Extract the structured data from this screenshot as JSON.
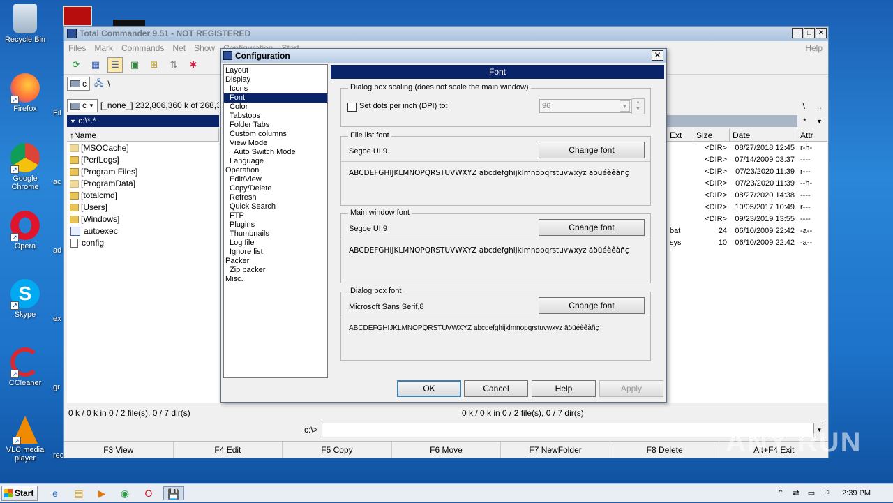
{
  "desktop": {
    "icons": [
      {
        "label": "Recycle Bin"
      },
      {
        "label": "Firefox"
      },
      {
        "label": "Google Chrome"
      },
      {
        "label": "Opera"
      },
      {
        "label": "Skype"
      },
      {
        "label": "CCleaner"
      },
      {
        "label": "VLC media player"
      }
    ],
    "partial_labels": [
      "Fil",
      "ac",
      "ad",
      "ex",
      "gr",
      "rec"
    ]
  },
  "main_window": {
    "title": "Total Commander 9.51 - NOT REGISTERED",
    "menu": [
      "Files",
      "Mark",
      "Commands",
      "Net",
      "Show",
      "Configuration",
      "Start"
    ],
    "help": "Help",
    "drive_letter": "c",
    "root_path": "\\",
    "left_drive_info": "[_none_]  232,806,360 k of 268,3",
    "left_path": "c:\\*.*",
    "col_name": "Name",
    "col_ext": "Ext",
    "col_size": "Size",
    "col_date": "Date",
    "col_attr": "Attr",
    "left_files": [
      {
        "name": "[MSOCache]",
        "type": "folder"
      },
      {
        "name": "[PerfLogs]",
        "type": "folder"
      },
      {
        "name": "[Program Files]",
        "type": "folder"
      },
      {
        "name": "[ProgramData]",
        "type": "folder"
      },
      {
        "name": "[totalcmd]",
        "type": "folder"
      },
      {
        "name": "[Users]",
        "type": "folder"
      },
      {
        "name": "[Windows]",
        "type": "folder"
      },
      {
        "name": "autoexec",
        "type": "bat"
      },
      {
        "name": "config",
        "type": "file"
      }
    ],
    "right_files": [
      {
        "ext": "",
        "size": "<DIR>",
        "date": "08/27/2018 12:45",
        "attr": "r-h-"
      },
      {
        "ext": "",
        "size": "<DIR>",
        "date": "07/14/2009 03:37",
        "attr": "----"
      },
      {
        "ext": "",
        "size": "<DIR>",
        "date": "07/23/2020 11:39",
        "attr": "r---"
      },
      {
        "ext": "",
        "size": "<DIR>",
        "date": "07/23/2020 11:39",
        "attr": "--h-"
      },
      {
        "ext": "",
        "size": "<DIR>",
        "date": "08/27/2020 14:38",
        "attr": "----"
      },
      {
        "ext": "",
        "size": "<DIR>",
        "date": "10/05/2017 10:49",
        "attr": "r---"
      },
      {
        "ext": "",
        "size": "<DIR>",
        "date": "09/23/2019 13:55",
        "attr": "----"
      },
      {
        "ext": "bat",
        "size": "24",
        "date": "06/10/2009 22:42",
        "attr": "-a--"
      },
      {
        "ext": "sys",
        "size": "10",
        "date": "06/10/2009 22:42",
        "attr": "-a--"
      }
    ],
    "right_nav": [
      "\\",
      ".."
    ],
    "right_star": "*",
    "status_left": "0 k / 0 k in 0 / 2 file(s), 0 / 7 dir(s)",
    "status_right": "0 k / 0 k in 0 / 2 file(s), 0 / 7 dir(s)",
    "cmd_prompt": "c:\\>",
    "fkeys": [
      "F3 View",
      "F4 Edit",
      "F5 Copy",
      "F6 Move",
      "F7 NewFolder",
      "F8 Delete",
      "Alt+F4 Exit"
    ]
  },
  "dialog": {
    "title": "Configuration",
    "page_header": "Font",
    "tree": [
      {
        "label": "Layout",
        "indent": 0
      },
      {
        "label": "Display",
        "indent": 0
      },
      {
        "label": "Icons",
        "indent": 1
      },
      {
        "label": "Font",
        "indent": 1,
        "selected": true
      },
      {
        "label": "Color",
        "indent": 1
      },
      {
        "label": "Tabstops",
        "indent": 1
      },
      {
        "label": "Folder Tabs",
        "indent": 1
      },
      {
        "label": "Custom columns",
        "indent": 1
      },
      {
        "label": "View Mode",
        "indent": 1
      },
      {
        "label": "Auto Switch Mode",
        "indent": 2
      },
      {
        "label": "Language",
        "indent": 1
      },
      {
        "label": "Operation",
        "indent": 0
      },
      {
        "label": "Edit/View",
        "indent": 1
      },
      {
        "label": "Copy/Delete",
        "indent": 1
      },
      {
        "label": "Refresh",
        "indent": 1
      },
      {
        "label": "Quick Search",
        "indent": 1
      },
      {
        "label": "FTP",
        "indent": 1
      },
      {
        "label": "Plugins",
        "indent": 1
      },
      {
        "label": "Thumbnails",
        "indent": 1
      },
      {
        "label": "Log file",
        "indent": 1
      },
      {
        "label": "Ignore list",
        "indent": 1
      },
      {
        "label": "Packer",
        "indent": 0
      },
      {
        "label": "Zip packer",
        "indent": 1
      },
      {
        "label": "Misc.",
        "indent": 0
      }
    ],
    "scaling_group": "Dialog box scaling (does not scale the main window)",
    "dpi_label": "Set dots per inch (DPI) to:",
    "dpi_value": "96",
    "file_list_group": "File list font",
    "file_list_font": "Segoe UI,9",
    "main_window_group": "Main window font",
    "main_window_font": "Segoe UI,9",
    "dialog_box_group": "Dialog box font",
    "dialog_box_font": "Microsoft Sans Serif,8",
    "change_font": "Change font",
    "sample": "ABCDEFGHIJKLMNOPQRSTUVWXYZ abcdefghijklmnopqrstuvwxyz äöüéèêàñç",
    "buttons": {
      "ok": "OK",
      "cancel": "Cancel",
      "help": "Help",
      "apply": "Apply"
    }
  },
  "taskbar": {
    "start": "Start",
    "clock": "2:39 PM"
  },
  "watermark": "ANY RUN"
}
